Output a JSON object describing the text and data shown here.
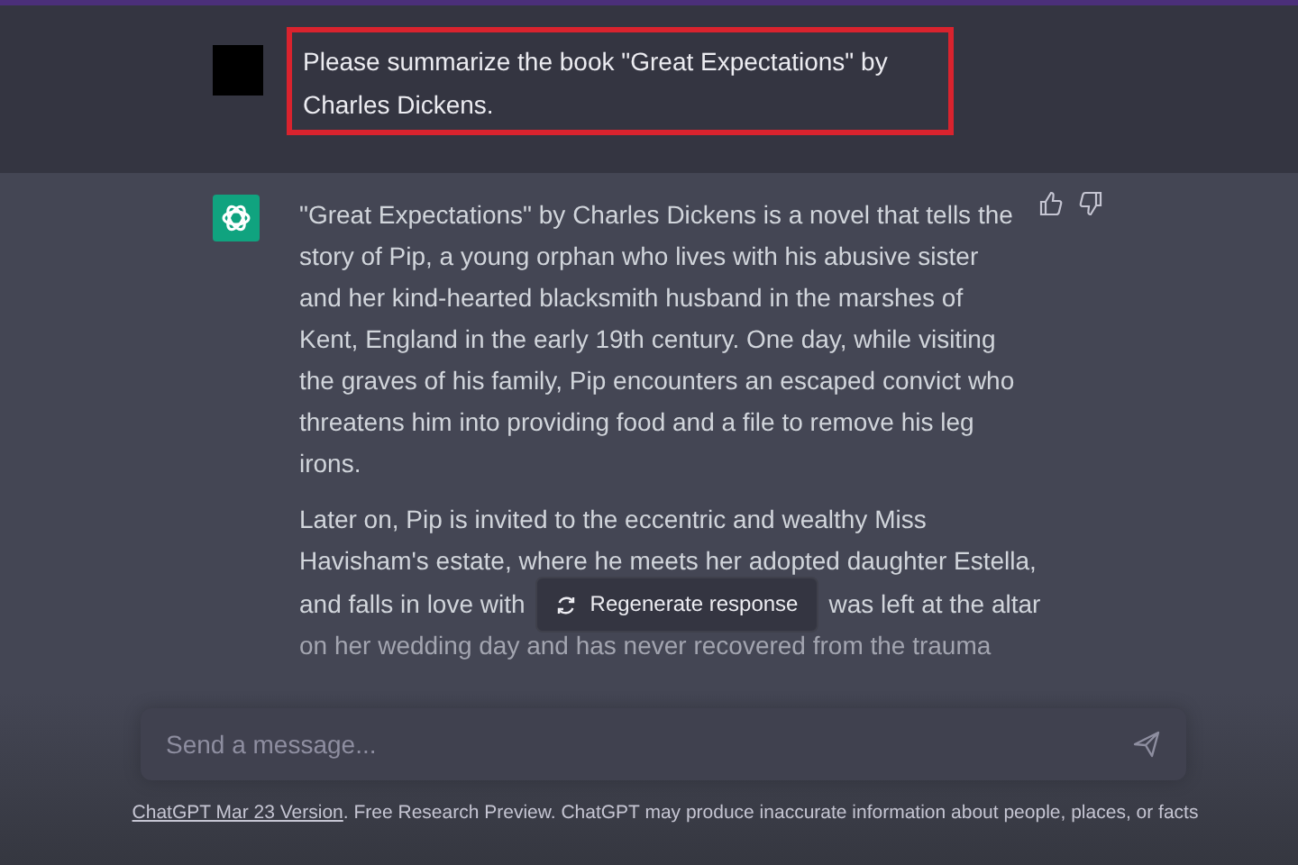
{
  "user_message": {
    "text": "Please summarize the book \"Great Expectations\" by Charles Dickens.",
    "highlighted": true
  },
  "response": {
    "paragraph_1": "\"Great Expectations\" by Charles Dickens is a novel that tells the story of Pip, a young orphan who lives with his abusive sister and her kind-hearted blacksmith husband in the marshes of Kent, England in the early 19th century. One day, while visiting the graves of his family, Pip encounters an escaped convict who threatens him into providing food and a file to remove his leg irons.",
    "paragraph_2_lines": [
      "Later on, Pip is invited to the eccentric and wealthy Miss",
      "Havisham's estate, where he meets her adopted daughter Estella,",
      "and falls in love with",
      "was left at the altar",
      "on her wedding day and has never recovered from the trauma"
    ]
  },
  "regenerate_button": {
    "label": "Regenerate response"
  },
  "composer": {
    "placeholder": "Send a message..."
  },
  "footer": {
    "link": "ChatGPT Mar 23 Version",
    "text": ". Free Research Preview. ChatGPT may produce inaccurate information about people, places, or facts"
  }
}
